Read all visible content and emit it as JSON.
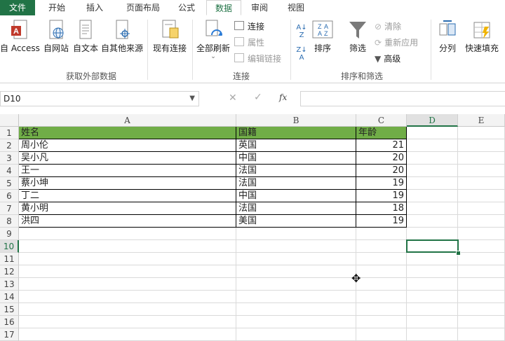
{
  "tabs": [
    "文件",
    "开始",
    "插入",
    "页面布局",
    "公式",
    "数据",
    "审阅",
    "视图"
  ],
  "active_tab": "数据",
  "ribbon": {
    "get_external": {
      "label": "获取外部数据",
      "buttons": [
        "自 Access",
        "自网站",
        "自文本",
        "自其他来源",
        "现有连接"
      ]
    },
    "connections": {
      "label": "连接",
      "refresh_all": "全部刷新",
      "items": [
        "连接",
        "属性",
        "编辑链接"
      ]
    },
    "sort_filter": {
      "label": "排序和筛选",
      "sort": "排序",
      "filter": "筛选",
      "items": [
        "清除",
        "重新应用",
        "高级"
      ]
    },
    "tools": [
      "分列",
      "快速填充"
    ]
  },
  "formula_bar": {
    "name_box": "D10",
    "fx": "fx",
    "content": ""
  },
  "columns": [
    "A",
    "B",
    "C",
    "D",
    "E"
  ],
  "selected_column": "D",
  "rows": [
    "1",
    "2",
    "3",
    "4",
    "5",
    "6",
    "7",
    "8",
    "9",
    "10",
    "11",
    "12",
    "13",
    "14",
    "15",
    "16",
    "17"
  ],
  "selected_row": "10",
  "table": {
    "headers": [
      "姓名",
      "国籍",
      "年龄"
    ],
    "records": [
      [
        "周小伦",
        "英国",
        "21"
      ],
      [
        "吴小凡",
        "中国",
        "20"
      ],
      [
        "王一",
        "法国",
        "20"
      ],
      [
        "蔡小坤",
        "法国",
        "19"
      ],
      [
        "丁二",
        "中国",
        "19"
      ],
      [
        "黄小明",
        "法国",
        "18"
      ],
      [
        "洪四",
        "美国",
        "19"
      ]
    ]
  },
  "colors": {
    "brand": "#217346",
    "header_fill": "#70ad47",
    "access_red": "#c0392b"
  }
}
